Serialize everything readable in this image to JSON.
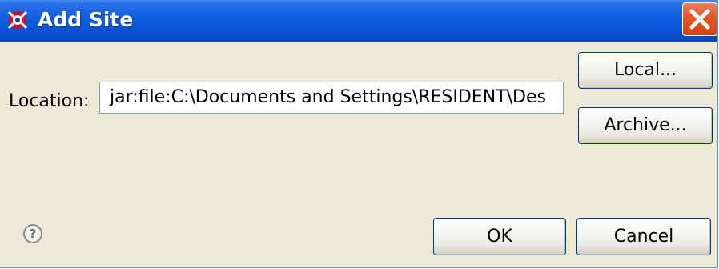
{
  "window": {
    "title": "Add Site",
    "icon": "eclipse-plugin-icon",
    "close_icon": "close-icon"
  },
  "form": {
    "location_label": "Location:",
    "location_value": "jar:file:C:\\Documents and Settings\\RESIDENT\\Des"
  },
  "buttons": {
    "local_label": "Local...",
    "archive_label": "Archive...",
    "ok_label": "OK",
    "cancel_label": "Cancel"
  },
  "help": {
    "glyph": "?",
    "icon": "help-icon"
  },
  "colors": {
    "titlebar": "#0a55d6",
    "close_button": "#e35a2a",
    "dialog_background": "#ece9d8",
    "button_border": "#003c74"
  }
}
